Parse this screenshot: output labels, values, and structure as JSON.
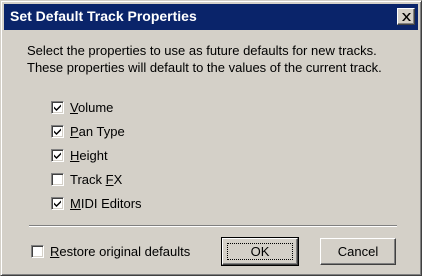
{
  "window": {
    "title": "Set Default Track Properties",
    "close_icon": "close-icon"
  },
  "description": {
    "line1": "Select the properties to use as future defaults for new tracks.",
    "line2": "These properties will default to the values of the current track."
  },
  "properties": [
    {
      "label": "Volume",
      "mnemonic": "V",
      "rest": "olume",
      "checked": true
    },
    {
      "label": "Pan Type",
      "mnemonic": "P",
      "rest": "an Type",
      "checked": true
    },
    {
      "label": "Height",
      "mnemonic": "H",
      "rest": "eight",
      "checked": true
    },
    {
      "label": "Track FX",
      "pre": "Track ",
      "mnemonic": "F",
      "rest": "X",
      "checked": false
    },
    {
      "label": "MIDI Editors",
      "mnemonic": "M",
      "rest": "IDI Editors",
      "checked": true
    }
  ],
  "restore": {
    "mnemonic": "R",
    "rest": "estore original defaults",
    "checked": false
  },
  "buttons": {
    "ok_label": "OK",
    "cancel_label": "Cancel"
  },
  "colors": {
    "titlebar": "#0a246a",
    "dialog_bg": "#d4d0c8"
  }
}
